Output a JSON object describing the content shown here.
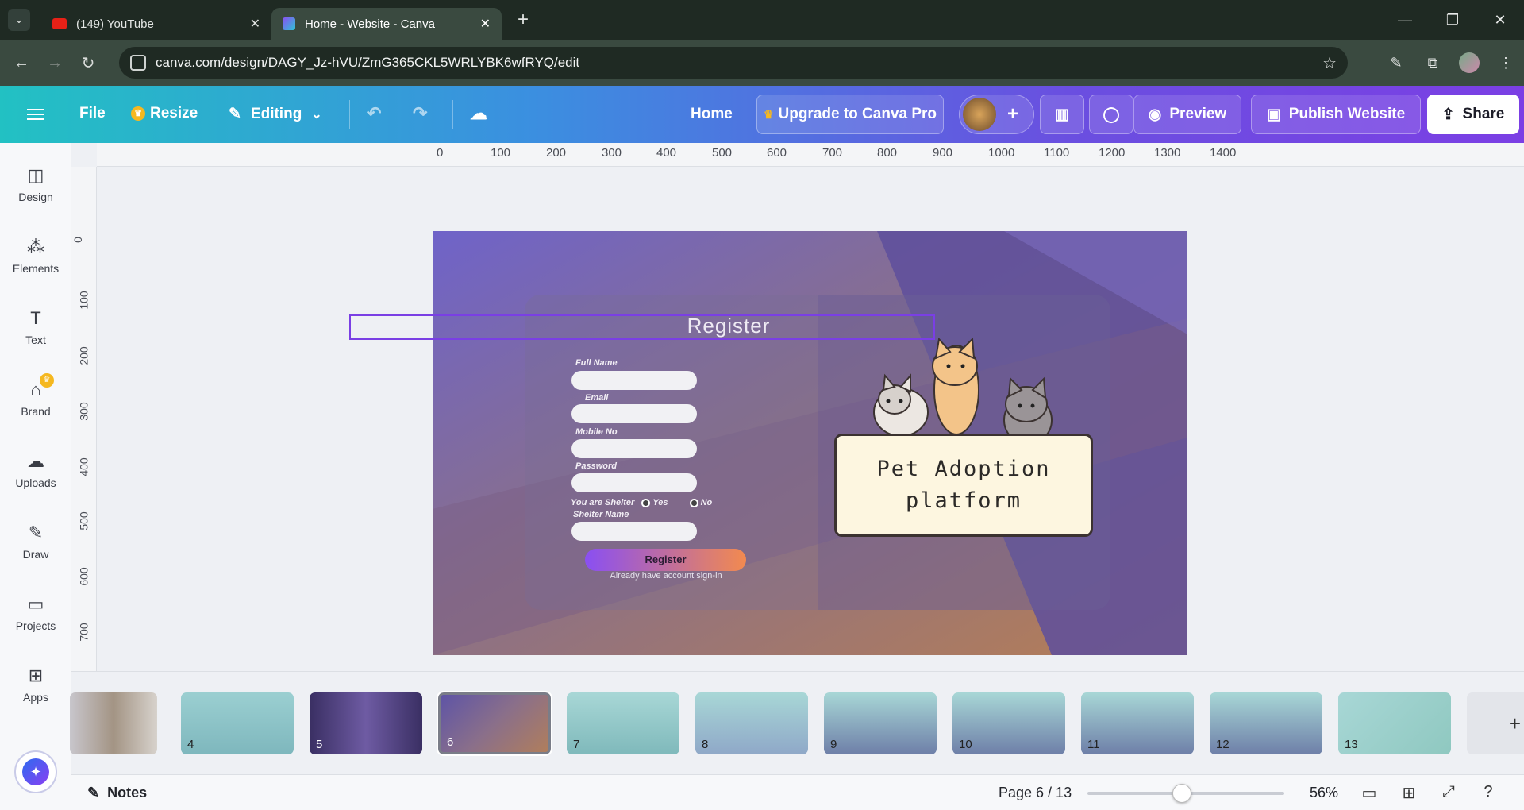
{
  "browser": {
    "tabs": [
      {
        "label": "(149) YouTube"
      },
      {
        "label": "Home - Website - Canva"
      }
    ],
    "url": "canva.com/design/DAGY_Jz-hVU/ZmG365CKL5WRLYBK6wfRYQ/edit"
  },
  "toolbar": {
    "file_label": "File",
    "resize_label": "Resize",
    "editing_label": "Editing",
    "page_name": "Home",
    "upgrade_label": "Upgrade to Canva Pro",
    "preview_label": "Preview",
    "publish_label": "Publish Website",
    "share_label": "Share"
  },
  "sidebar": {
    "items": [
      {
        "label": "Design",
        "icon": "design-icon"
      },
      {
        "label": "Elements",
        "icon": "elements-icon"
      },
      {
        "label": "Text",
        "icon": "text-icon"
      },
      {
        "label": "Brand",
        "icon": "brand-icon"
      },
      {
        "label": "Uploads",
        "icon": "uploads-icon"
      },
      {
        "label": "Draw",
        "icon": "draw-icon"
      },
      {
        "label": "Projects",
        "icon": "projects-icon"
      },
      {
        "label": "Apps",
        "icon": "apps-icon"
      }
    ]
  },
  "rulers": {
    "top": [
      "0",
      "100",
      "200",
      "300",
      "400",
      "500",
      "600",
      "700",
      "800",
      "900",
      "1000",
      "1100",
      "1200",
      "1300",
      "1400"
    ],
    "left": [
      "0",
      "100",
      "200",
      "300",
      "400",
      "500",
      "600",
      "700"
    ]
  },
  "design": {
    "title": "Register",
    "fields": [
      "Full Name",
      "Email",
      "Mobile No",
      "Password"
    ],
    "shelter_question": "You are Shelter",
    "yes_label": "Yes",
    "no_label": "No",
    "shelter_name_label": "Shelter Name",
    "register_button": "Register",
    "signin_text": "Already have account sign-in",
    "board_line1": "Pet Adoption",
    "board_line2": "platform"
  },
  "thumbnails": [
    "",
    "4",
    "5",
    "6",
    "7",
    "8",
    "9",
    "10",
    "11",
    "12",
    "13"
  ],
  "footer": {
    "notes_label": "Notes",
    "page_indicator": "Page 6 / 13",
    "zoom": "56%",
    "zoom_level": 0.43
  },
  "colors": {
    "accent": "#7b3fe4",
    "selection": "#7a3fe4"
  }
}
